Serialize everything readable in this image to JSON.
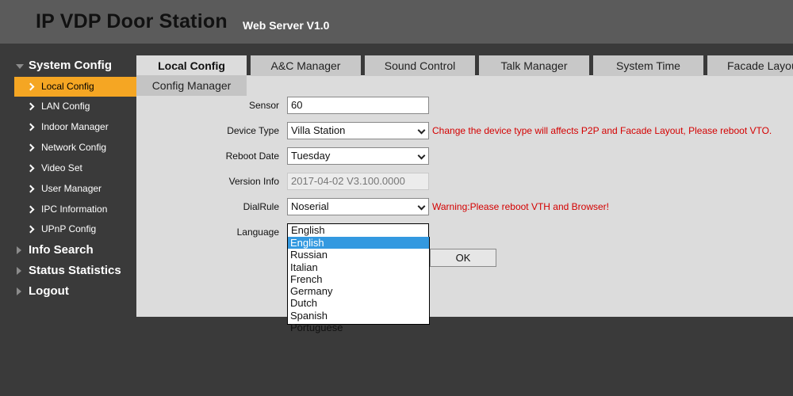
{
  "header": {
    "title": "IP VDP Door Station",
    "subtitle": "Web Server V1.0"
  },
  "sidebar": {
    "system_config": "System Config",
    "items": [
      "Local Config",
      "LAN Config",
      "Indoor Manager",
      "Network Config",
      "Video Set",
      "User Manager",
      "IPC Information",
      "UPnP Config"
    ],
    "info_search": "Info Search",
    "status_statistics": "Status Statistics",
    "logout": "Logout"
  },
  "tabs": [
    "Local Config",
    "A&C Manager",
    "Sound Control",
    "Talk Manager",
    "System Time",
    "Facade Layout"
  ],
  "subtab": "Config Manager",
  "form": {
    "sensor_label": "Sensor",
    "sensor_value": "60",
    "device_type_label": "Device Type",
    "device_type_value": "Villa Station",
    "device_type_warning": "Change the device type will affects P2P and Facade Layout, Please reboot VTO.",
    "reboot_date_label": "Reboot Date",
    "reboot_date_value": "Tuesday",
    "version_label": "Version Info",
    "version_value": "2017-04-02 V3.100.0000",
    "dialrule_label": "DialRule",
    "dialrule_value": "Noserial",
    "dialrule_warning": "Warning:Please reboot VTH and Browser!",
    "language_label": "Language",
    "language_value": "English",
    "language_options": [
      "English",
      "Russian",
      "Italian",
      "French",
      "Germany",
      "Dutch",
      "Spanish",
      "Portuguese"
    ]
  },
  "ok_label": "OK",
  "colors": {
    "accent": "#f5a623",
    "warning": "#d40000",
    "selection": "#3399e0"
  }
}
